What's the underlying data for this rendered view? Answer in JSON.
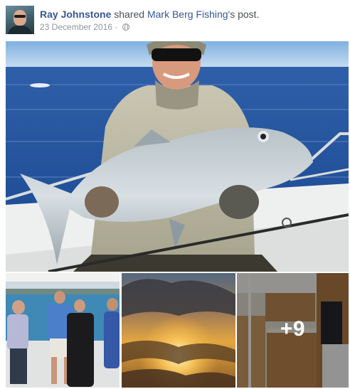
{
  "post": {
    "author_name": "Ray Johnstone",
    "action_text": "shared",
    "source_page": "Mark Berg Fishing",
    "possessive_suffix": "'s post.",
    "date": "23 December 2016",
    "separator": "·",
    "privacy_icon": "globe-icon"
  },
  "photos": {
    "more_count": "+9"
  },
  "colors": {
    "link": "#365899",
    "secondary_text": "#90949c",
    "body_text": "#4b4f56"
  }
}
